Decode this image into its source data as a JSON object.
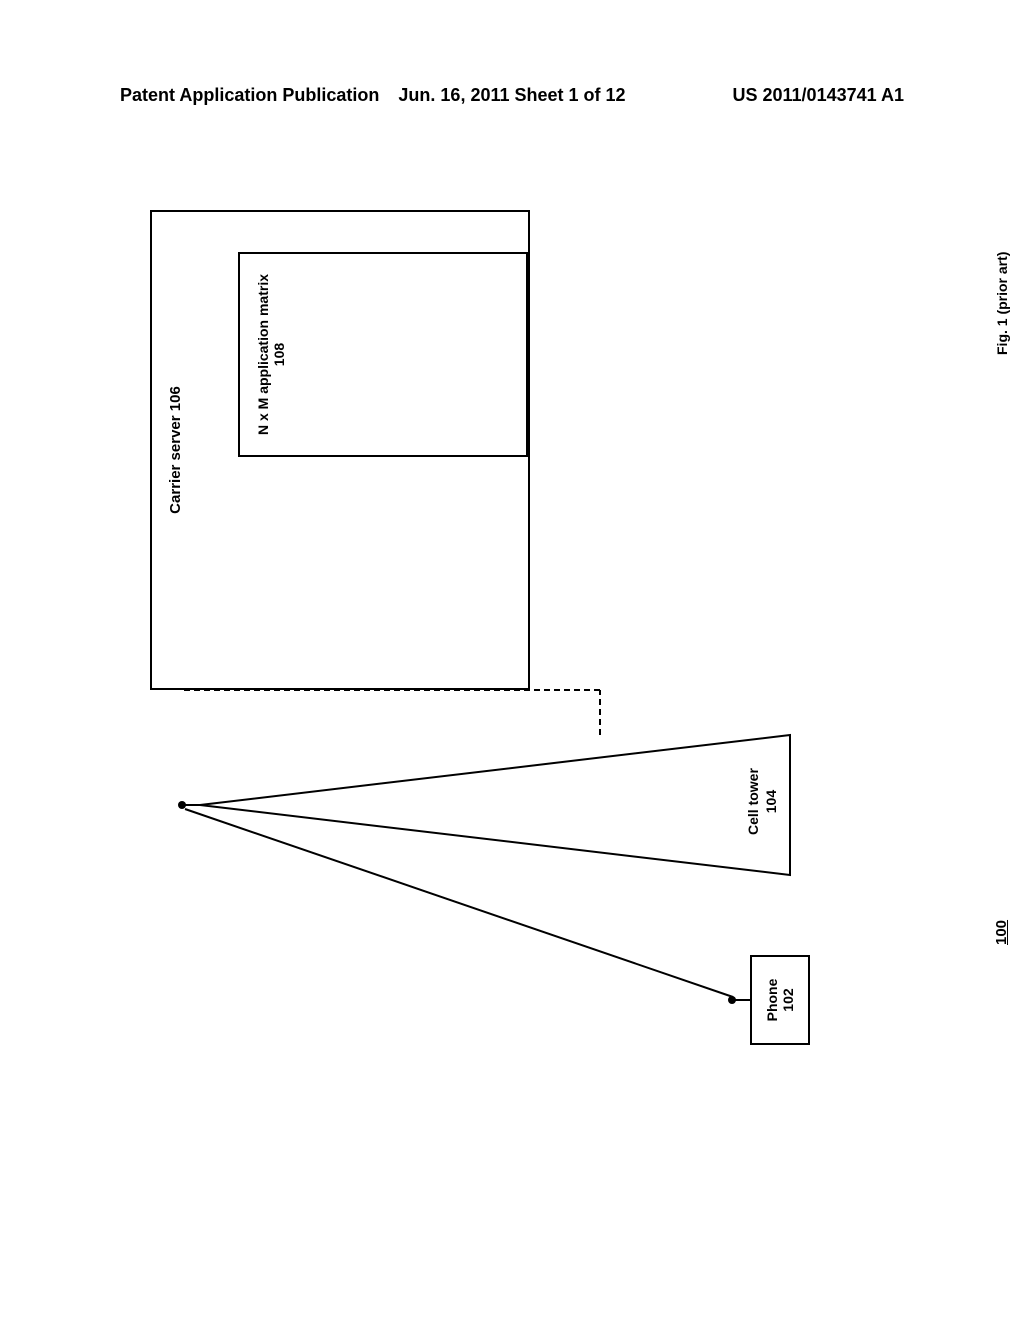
{
  "header": {
    "left": "Patent Application Publication",
    "center": "Jun. 16, 2011  Sheet 1 of 12",
    "right": "US 2011/0143741 A1"
  },
  "diagram": {
    "phone": {
      "label": "Phone",
      "ref": "102"
    },
    "tower": {
      "label": "Cell tower",
      "ref": "104"
    },
    "server": {
      "label": "Carrier server 106"
    },
    "matrix": {
      "label": "N x M application matrix",
      "ref": "108"
    },
    "main_ref": "100",
    "figure_caption": "Fig. 1 (prior art)"
  }
}
